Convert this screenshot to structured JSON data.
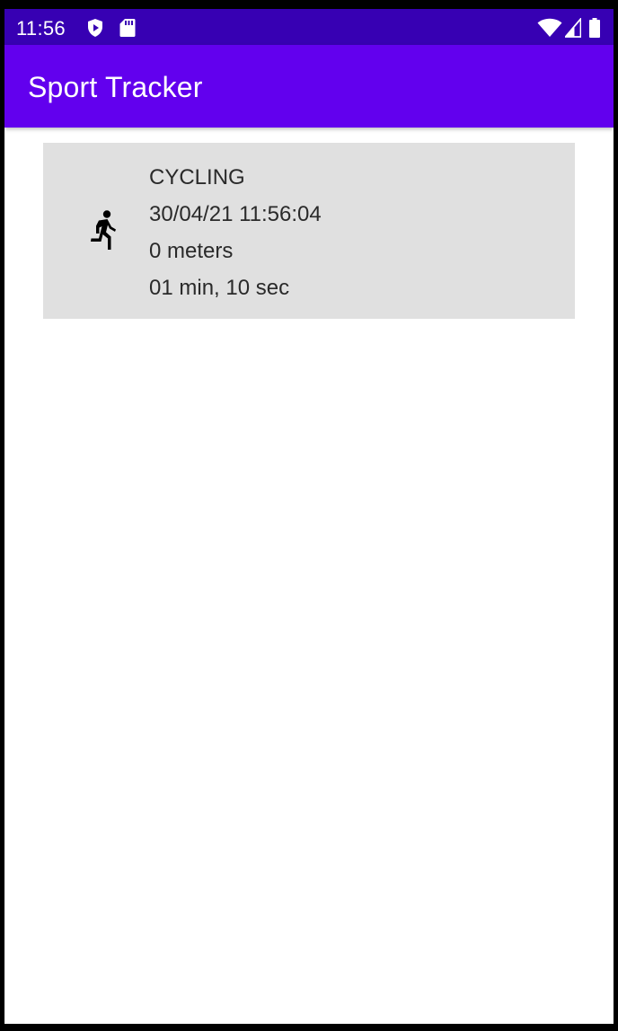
{
  "status_bar": {
    "time": "11:56",
    "left_icons": [
      "shield-play-icon",
      "sd-card-icon"
    ],
    "right_icons": [
      "wifi-icon",
      "cell-signal-icon",
      "battery-icon"
    ]
  },
  "app_bar": {
    "title": "Sport Tracker"
  },
  "activities": [
    {
      "icon": "running-person-icon",
      "type": "CYCLING",
      "datetime": "30/04/21 11:56:04",
      "distance": "0 meters",
      "duration": "01 min, 10 sec"
    }
  ],
  "colors": {
    "status_bar": "#3700b3",
    "app_bar": "#6200ee",
    "card_background": "#e0e0e0",
    "card_text": "#2a2a2a"
  }
}
